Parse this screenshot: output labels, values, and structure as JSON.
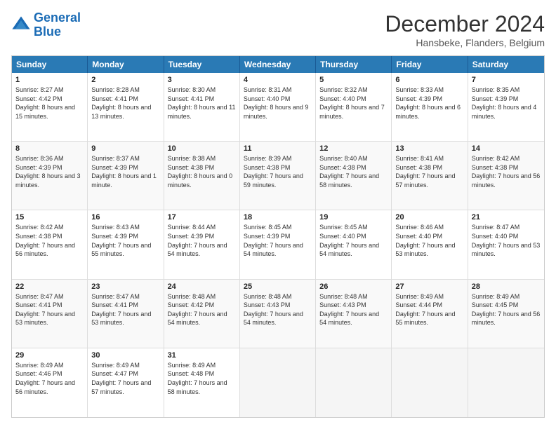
{
  "logo": {
    "line1": "General",
    "line2": "Blue"
  },
  "title": "December 2024",
  "subtitle": "Hansbeke, Flanders, Belgium",
  "header_days": [
    "Sunday",
    "Monday",
    "Tuesday",
    "Wednesday",
    "Thursday",
    "Friday",
    "Saturday"
  ],
  "weeks": [
    [
      {
        "day": "1",
        "sunrise": "8:27 AM",
        "sunset": "4:42 PM",
        "daylight": "8 hours and 15 minutes."
      },
      {
        "day": "2",
        "sunrise": "8:28 AM",
        "sunset": "4:41 PM",
        "daylight": "8 hours and 13 minutes."
      },
      {
        "day": "3",
        "sunrise": "8:30 AM",
        "sunset": "4:41 PM",
        "daylight": "8 hours and 11 minutes."
      },
      {
        "day": "4",
        "sunrise": "8:31 AM",
        "sunset": "4:40 PM",
        "daylight": "8 hours and 9 minutes."
      },
      {
        "day": "5",
        "sunrise": "8:32 AM",
        "sunset": "4:40 PM",
        "daylight": "8 hours and 7 minutes."
      },
      {
        "day": "6",
        "sunrise": "8:33 AM",
        "sunset": "4:39 PM",
        "daylight": "8 hours and 6 minutes."
      },
      {
        "day": "7",
        "sunrise": "8:35 AM",
        "sunset": "4:39 PM",
        "daylight": "8 hours and 4 minutes."
      }
    ],
    [
      {
        "day": "8",
        "sunrise": "8:36 AM",
        "sunset": "4:39 PM",
        "daylight": "8 hours and 3 minutes."
      },
      {
        "day": "9",
        "sunrise": "8:37 AM",
        "sunset": "4:39 PM",
        "daylight": "8 hours and 1 minute."
      },
      {
        "day": "10",
        "sunrise": "8:38 AM",
        "sunset": "4:38 PM",
        "daylight": "8 hours and 0 minutes."
      },
      {
        "day": "11",
        "sunrise": "8:39 AM",
        "sunset": "4:38 PM",
        "daylight": "7 hours and 59 minutes."
      },
      {
        "day": "12",
        "sunrise": "8:40 AM",
        "sunset": "4:38 PM",
        "daylight": "7 hours and 58 minutes."
      },
      {
        "day": "13",
        "sunrise": "8:41 AM",
        "sunset": "4:38 PM",
        "daylight": "7 hours and 57 minutes."
      },
      {
        "day": "14",
        "sunrise": "8:42 AM",
        "sunset": "4:38 PM",
        "daylight": "7 hours and 56 minutes."
      }
    ],
    [
      {
        "day": "15",
        "sunrise": "8:42 AM",
        "sunset": "4:38 PM",
        "daylight": "7 hours and 56 minutes."
      },
      {
        "day": "16",
        "sunrise": "8:43 AM",
        "sunset": "4:39 PM",
        "daylight": "7 hours and 55 minutes."
      },
      {
        "day": "17",
        "sunrise": "8:44 AM",
        "sunset": "4:39 PM",
        "daylight": "7 hours and 54 minutes."
      },
      {
        "day": "18",
        "sunrise": "8:45 AM",
        "sunset": "4:39 PM",
        "daylight": "7 hours and 54 minutes."
      },
      {
        "day": "19",
        "sunrise": "8:45 AM",
        "sunset": "4:40 PM",
        "daylight": "7 hours and 54 minutes."
      },
      {
        "day": "20",
        "sunrise": "8:46 AM",
        "sunset": "4:40 PM",
        "daylight": "7 hours and 53 minutes."
      },
      {
        "day": "21",
        "sunrise": "8:47 AM",
        "sunset": "4:40 PM",
        "daylight": "7 hours and 53 minutes."
      }
    ],
    [
      {
        "day": "22",
        "sunrise": "8:47 AM",
        "sunset": "4:41 PM",
        "daylight": "7 hours and 53 minutes."
      },
      {
        "day": "23",
        "sunrise": "8:47 AM",
        "sunset": "4:41 PM",
        "daylight": "7 hours and 53 minutes."
      },
      {
        "day": "24",
        "sunrise": "8:48 AM",
        "sunset": "4:42 PM",
        "daylight": "7 hours and 54 minutes."
      },
      {
        "day": "25",
        "sunrise": "8:48 AM",
        "sunset": "4:43 PM",
        "daylight": "7 hours and 54 minutes."
      },
      {
        "day": "26",
        "sunrise": "8:48 AM",
        "sunset": "4:43 PM",
        "daylight": "7 hours and 54 minutes."
      },
      {
        "day": "27",
        "sunrise": "8:49 AM",
        "sunset": "4:44 PM",
        "daylight": "7 hours and 55 minutes."
      },
      {
        "day": "28",
        "sunrise": "8:49 AM",
        "sunset": "4:45 PM",
        "daylight": "7 hours and 56 minutes."
      }
    ],
    [
      {
        "day": "29",
        "sunrise": "8:49 AM",
        "sunset": "4:46 PM",
        "daylight": "7 hours and 56 minutes."
      },
      {
        "day": "30",
        "sunrise": "8:49 AM",
        "sunset": "4:47 PM",
        "daylight": "7 hours and 57 minutes."
      },
      {
        "day": "31",
        "sunrise": "8:49 AM",
        "sunset": "4:48 PM",
        "daylight": "7 hours and 58 minutes."
      },
      null,
      null,
      null,
      null
    ]
  ]
}
